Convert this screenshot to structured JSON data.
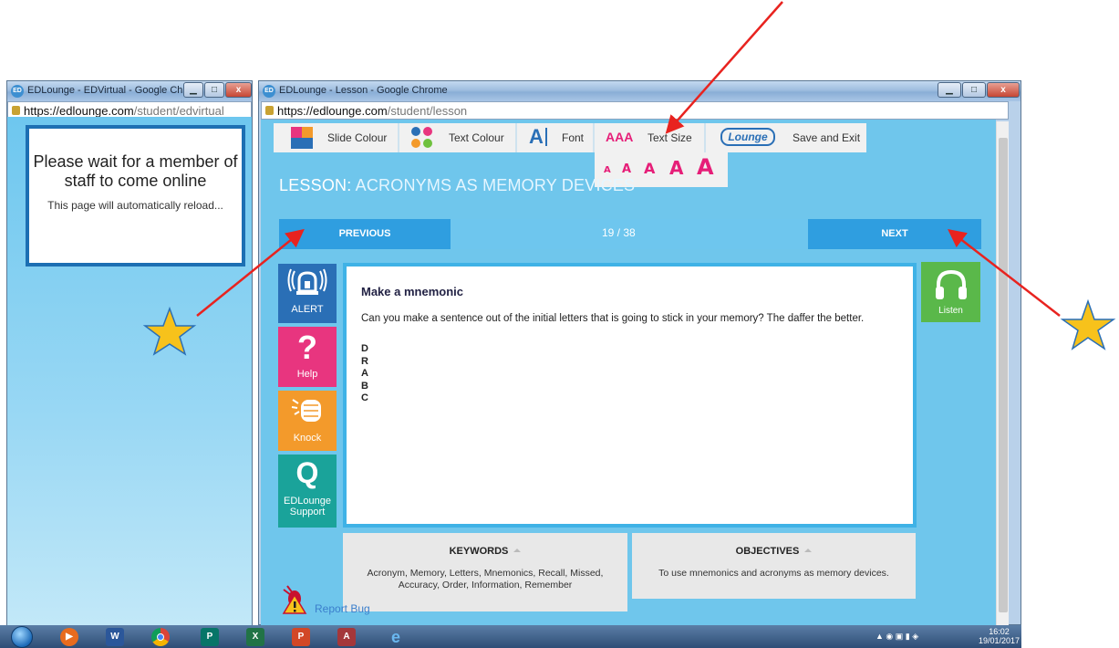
{
  "left_window": {
    "title": "EDLounge - EDVirtual - Google Chro...",
    "url_domain": "https://edlounge.com",
    "url_path": "/student/edvirtual",
    "wait_message": "Please wait for a member of staff to come online",
    "reload_message": "This page will automatically reload..."
  },
  "right_window": {
    "title": "EDLounge - Lesson - Google Chrome",
    "url_domain": "https://edlounge.com",
    "url_path": "/student/lesson"
  },
  "toolbar": {
    "slide_colour": "Slide Colour",
    "text_colour": "Text Colour",
    "font_glyph": "A",
    "font": "Font",
    "text_size_glyph": "AAA",
    "text_size": "Text Size",
    "logo_text": "Lounge",
    "save_exit": "Save and Exit",
    "size_options": [
      "A",
      "A",
      "A",
      "A",
      "A"
    ]
  },
  "lesson": {
    "prefix": "LESSON:",
    "title": "ACRONYMS AS MEMORY DEVICES",
    "previous": "PREVIOUS",
    "next": "NEXT",
    "pager": "19 / 38",
    "heading": "Make a mnemonic",
    "body": "Can you make a sentence out of the initial letters that is going to stick in your memory? The daffer the better.",
    "letters": [
      "D",
      "R",
      "A",
      "B",
      "C"
    ]
  },
  "side_buttons": {
    "alert": "ALERT",
    "help_glyph": "?",
    "help": "Help",
    "knock": "Knock",
    "support_glyph": "Q",
    "support_line1": "EDLounge",
    "support_line2": "Support"
  },
  "listen": "Listen",
  "keywords": {
    "header": "KEYWORDS",
    "text": "Acronym, Memory, Letters, Mnemonics, Recall, Missed, Accuracy, Order, Information, Remember"
  },
  "objectives": {
    "header": "OBJECTIVES",
    "text": "To use mnemonics and acronyms as memory devices."
  },
  "report_bug": "Report Bug",
  "taskbar": {
    "time": "16:02",
    "date": "19/01/2017",
    "word_glyph": "W",
    "publisher_glyph": "P",
    "excel_glyph": "X",
    "powerpoint_glyph": "P",
    "access_glyph": "A"
  },
  "colors": {
    "lesson_bg": "#6fc6ec",
    "nav_button": "#2f9ee0",
    "alert": "#2a6fb6",
    "help": "#e8357f",
    "knock": "#f39a2b",
    "support": "#1aa39a",
    "listen": "#5ab84a",
    "annotation_arrow": "#e8231f",
    "star": "#f7c21b"
  }
}
